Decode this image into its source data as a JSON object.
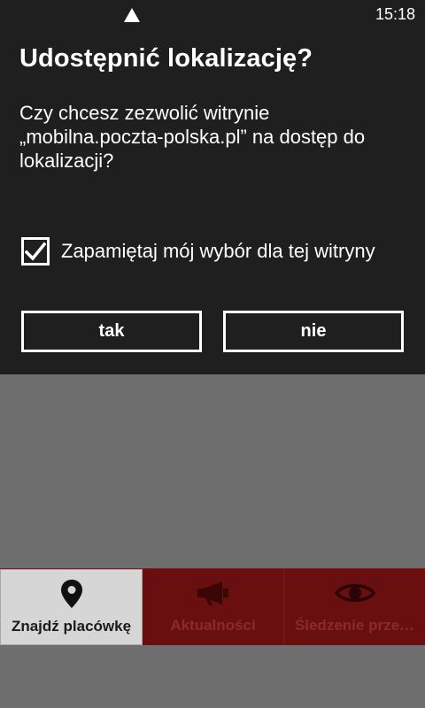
{
  "status_bar": {
    "time": "15:18",
    "signal_icon": "signal-triangle-icon"
  },
  "dialog": {
    "title": "Udostępnić lokalizację?",
    "message": "Czy chcesz zezwolić witrynie\n„mobilna.poczta-polska.pl” na dostęp do\nlokalizacji?",
    "remember_label": "Zapamiętaj mój wybór dla tej witryny",
    "remember_checked": true,
    "yes_label": "tak",
    "no_label": "nie"
  },
  "tabbar": {
    "tabs": [
      {
        "label": "Znajdź placówkę",
        "icon": "map-pin-icon",
        "active": true
      },
      {
        "label": "Aktualności",
        "icon": "megaphone-icon",
        "active": false
      },
      {
        "label": "Śledzenie prze…",
        "icon": "eye-icon",
        "active": false
      }
    ]
  },
  "colors": {
    "dialog_bg": "#1f1f1f",
    "page_bg": "#6e6e6e",
    "tabbar_bg": "#6a0f10",
    "active_tab_bg": "#d6d6d6"
  }
}
